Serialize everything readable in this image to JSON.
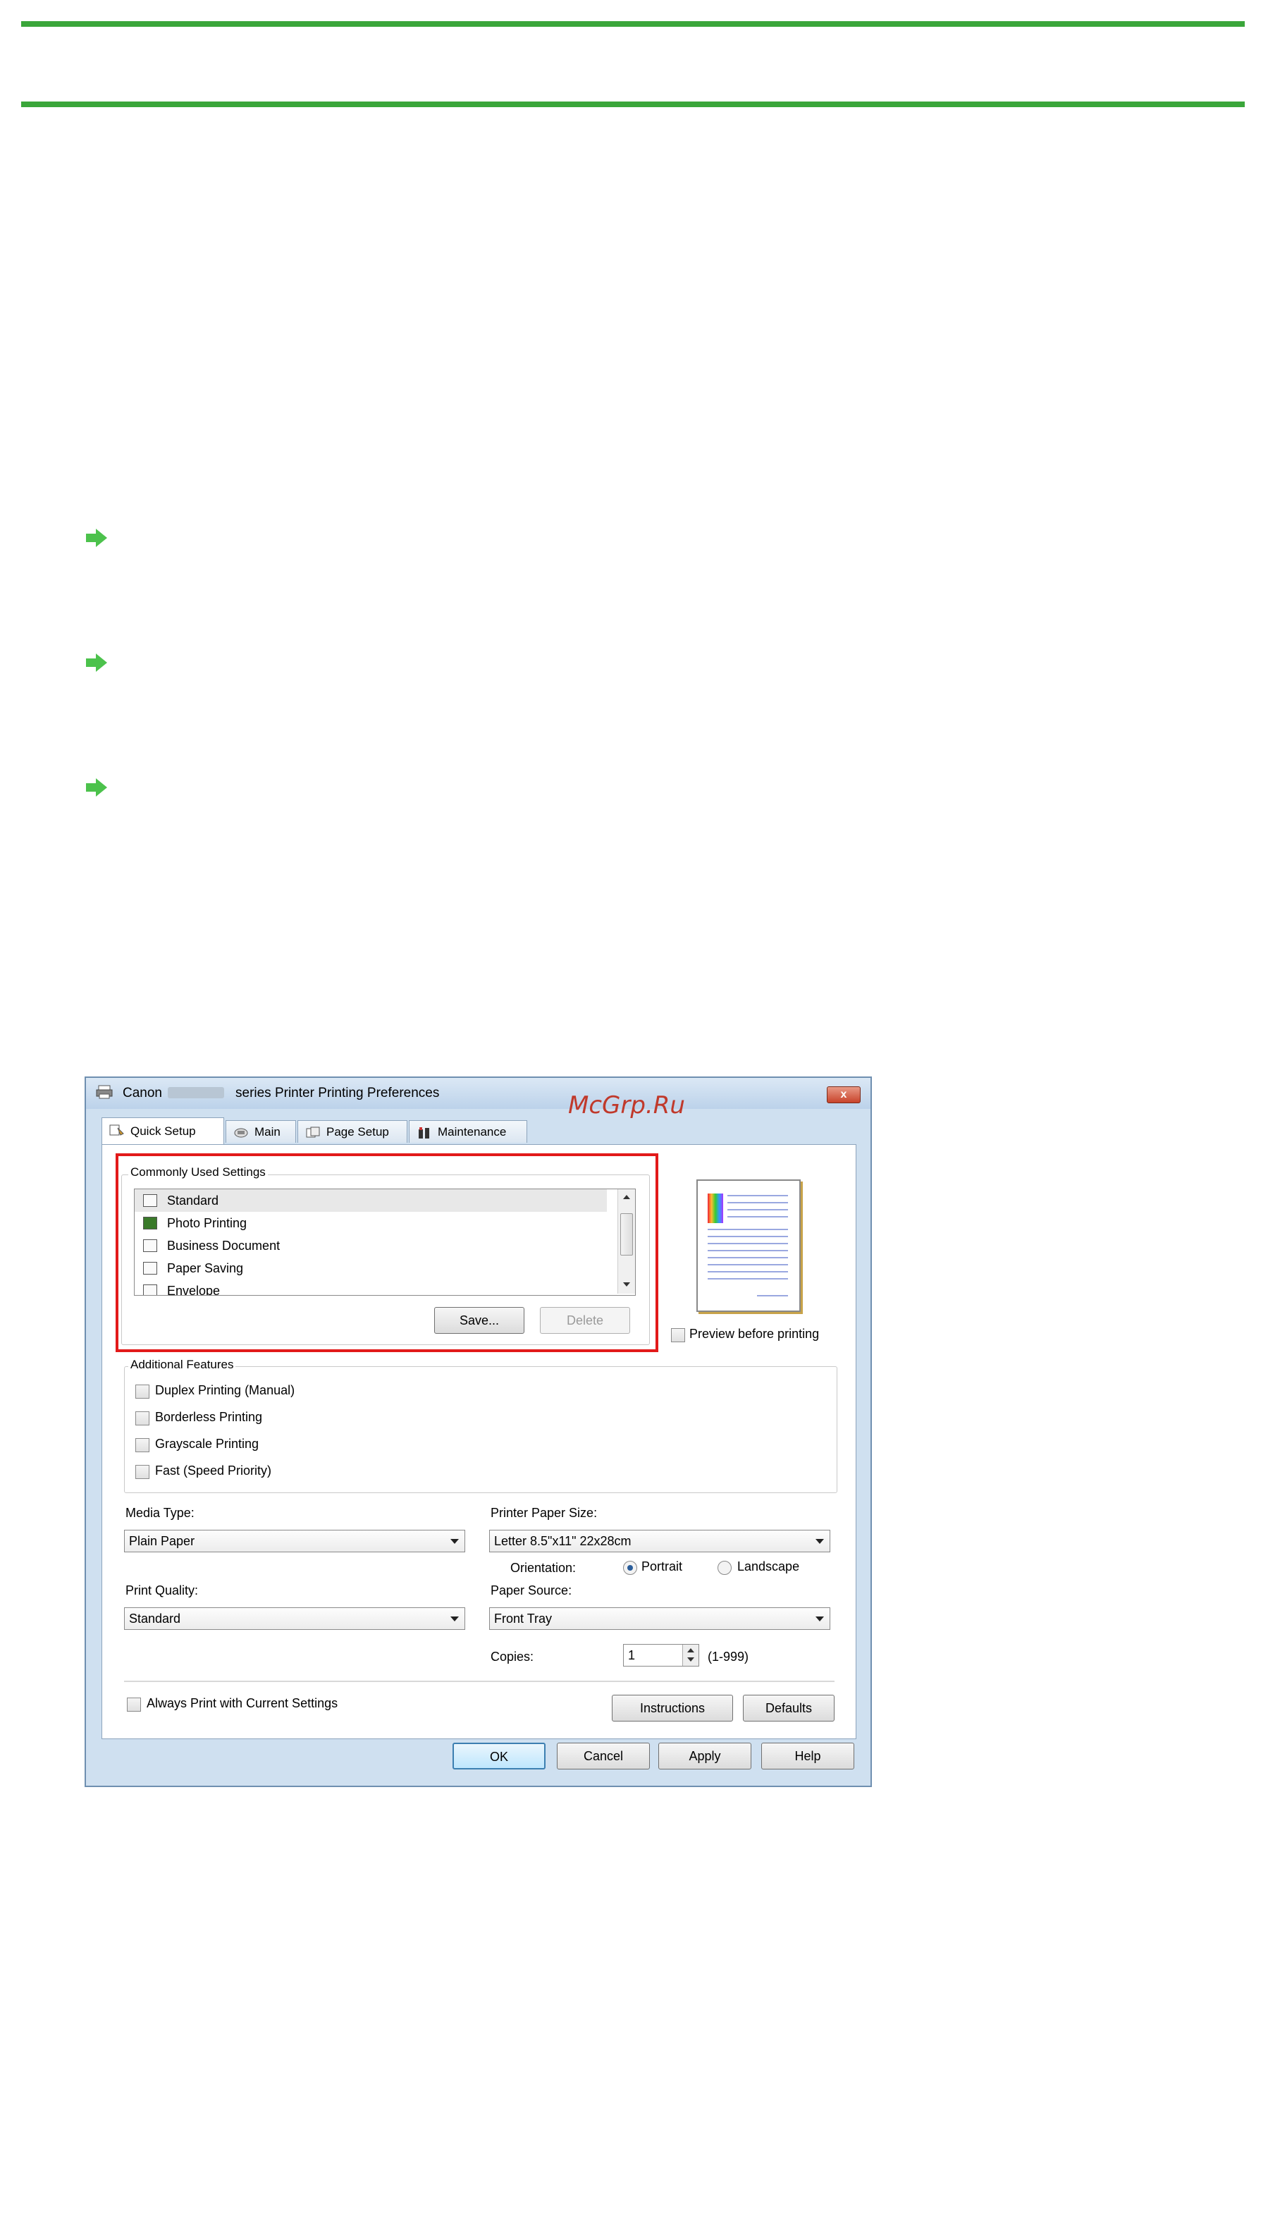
{
  "window": {
    "title_prefix": "Canon",
    "title_suffix": "series Printer Printing Preferences",
    "close": "x"
  },
  "watermark": "McGrp.Ru",
  "tabs": [
    {
      "label": "Quick Setup",
      "icon": "quick-setup-icon",
      "active": true
    },
    {
      "label": "Main",
      "icon": "main-icon"
    },
    {
      "label": "Page Setup",
      "icon": "page-setup-icon"
    },
    {
      "label": "Maintenance",
      "icon": "maintenance-icon"
    }
  ],
  "commonly_used": {
    "label": "Commonly Used Settings",
    "items": [
      "Standard",
      "Photo Printing",
      "Business Document",
      "Paper Saving",
      "Envelope"
    ],
    "save_label": "Save...",
    "delete_label": "Delete"
  },
  "preview": {
    "label": "Preview before printing"
  },
  "additional_features": {
    "label": "Additional Features",
    "options": [
      "Duplex Printing (Manual)",
      "Borderless Printing",
      "Grayscale Printing",
      "Fast (Speed Priority)"
    ]
  },
  "media_type": {
    "label": "Media Type:",
    "value": "Plain Paper"
  },
  "paper_size": {
    "label": "Printer Paper Size:",
    "value": "Letter 8.5\"x11\" 22x28cm"
  },
  "orientation": {
    "label": "Orientation:",
    "portrait": "Portrait",
    "landscape": "Landscape"
  },
  "print_quality": {
    "label": "Print Quality:",
    "value": "Standard"
  },
  "paper_source": {
    "label": "Paper Source:",
    "value": "Front Tray"
  },
  "copies": {
    "label": "Copies:",
    "value": "1",
    "range": "(1-999)"
  },
  "always_print": {
    "label": "Always Print with Current Settings"
  },
  "buttons": {
    "instructions": "Instructions",
    "defaults": "Defaults",
    "ok": "OK",
    "cancel": "Cancel",
    "apply": "Apply",
    "help": "Help"
  },
  "colors": {
    "accent_rule": "#3aa63a",
    "bullet": "#4cc24c",
    "highlight_box": "#e21a1a"
  }
}
